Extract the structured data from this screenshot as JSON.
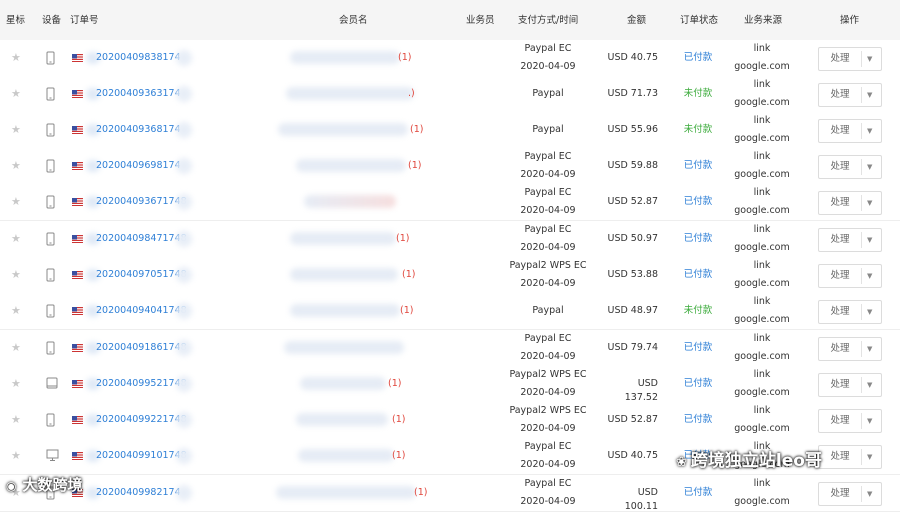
{
  "columns": {
    "star": "星标",
    "device": "设备",
    "order_no": "订单号",
    "member": "会员名",
    "salesperson": "业务员",
    "payment": "支付方式/时间",
    "amount": "金额",
    "status": "订单状态",
    "source": "业务来源",
    "action": "操作"
  },
  "rows": [
    {
      "device": "phone-icon",
      "order_no": "20200409838174",
      "count": "(1)",
      "pay": "Paypal EC",
      "date": "2020-04-09",
      "amount": "USD 40.75",
      "status": "已付款",
      "status_color": "#2e7fd6",
      "src1": "link",
      "src2": "google.com",
      "action": "处理"
    },
    {
      "device": "phone-icon",
      "order_no": "20200409363174",
      "count": ".)",
      "pay": "Paypal",
      "date": "",
      "amount": "USD 71.73",
      "status": "未付款",
      "status_color": "#3cab3c",
      "src1": "link",
      "src2": "google.com",
      "action": "处理"
    },
    {
      "device": "phone-icon",
      "order_no": "20200409368174",
      "count": "(1)",
      "pay": "Paypal",
      "date": "",
      "amount": "USD 55.96",
      "status": "未付款",
      "status_color": "#3cab3c",
      "src1": "link",
      "src2": "google.com",
      "action": "处理"
    },
    {
      "device": "phone-icon",
      "order_no": "20200409698174",
      "count": "(1)",
      "pay": "Paypal EC",
      "date": "2020-04-09",
      "amount": "USD 59.88",
      "status": "已付款",
      "status_color": "#2e7fd6",
      "src1": "link",
      "src2": "google.com",
      "action": "处理"
    },
    {
      "device": "phone-icon",
      "order_no": "202004093671748",
      "count": "",
      "pay": "Paypal EC",
      "date": "2020-04-09",
      "amount": "USD 52.87",
      "status": "已付款",
      "status_color": "#2e7fd6",
      "src1": "link",
      "src2": "google.com",
      "action": "处理"
    },
    {
      "device": "phone-icon",
      "order_no": "202004098471748",
      "count": "(1)",
      "pay": "Paypal EC",
      "date": "2020-04-09",
      "amount": "USD 50.97",
      "status": "已付款",
      "status_color": "#2e7fd6",
      "src1": "link",
      "src2": "google.com",
      "action": "处理"
    },
    {
      "device": "phone-icon",
      "order_no": "202004097051748",
      "count": "(1)",
      "pay": "Paypal2 WPS EC",
      "date": "2020-04-09",
      "amount": "USD 53.88",
      "status": "已付款",
      "status_color": "#2e7fd6",
      "src1": "link",
      "src2": "google.com",
      "action": "处理"
    },
    {
      "device": "phone-icon",
      "order_no": "202004094041748",
      "count": "(1)",
      "pay": "Paypal",
      "date": "",
      "amount": "USD 48.97",
      "status": "未付款",
      "status_color": "#3cab3c",
      "src1": "link",
      "src2": "google.com",
      "action": "处理"
    },
    {
      "device": "phone-icon",
      "order_no": "202004091861748",
      "count": "",
      "pay": "Paypal EC",
      "date": "2020-04-09",
      "amount": "USD 79.74",
      "status": "已付款",
      "status_color": "#2e7fd6",
      "src1": "link",
      "src2": "google.com",
      "action": "处理"
    },
    {
      "device": "tablet-icon",
      "order_no": "202004099521748",
      "count": "(1)",
      "pay": "Paypal2 WPS EC",
      "date": "2020-04-09",
      "amount": "USD 137.52",
      "status": "已付款",
      "status_color": "#2e7fd6",
      "src1": "link",
      "src2": "google.com",
      "action": "处理"
    },
    {
      "device": "phone-icon",
      "order_no": "202004099221748",
      "count": "(1)",
      "pay": "Paypal2 WPS EC",
      "date": "2020-04-09",
      "amount": "USD 52.87",
      "status": "已付款",
      "status_color": "#2e7fd6",
      "src1": "link",
      "src2": "google.com",
      "action": "处理"
    },
    {
      "device": "desktop-icon",
      "order_no": "202004099101748",
      "count": "(1)",
      "pay": "Paypal EC",
      "date": "2020-04-09",
      "amount": "USD 40.75",
      "status": "已付款",
      "status_color": "#2e7fd6",
      "src1": "link",
      "src2": "google.com",
      "action": "处理"
    },
    {
      "device": "phone-icon",
      "order_no": "20200409982174",
      "count": "(1)",
      "pay": "Paypal EC",
      "date": "2020-04-09",
      "amount": "USD 100.11",
      "status": "已付款",
      "status_color": "#2e7fd6",
      "src1": "link",
      "src2": "google.com",
      "action": "处理"
    }
  ],
  "watermarks": {
    "left_text": "大数跨境",
    "right_text": "跨境独立站leo哥"
  }
}
